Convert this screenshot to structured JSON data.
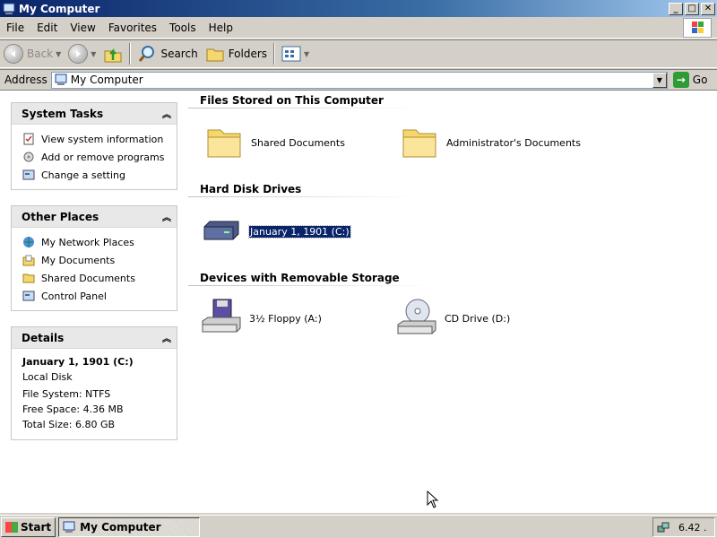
{
  "window": {
    "title": "My Computer",
    "buttons": {
      "minimize": "_",
      "maximize": "□",
      "close": "✕"
    }
  },
  "menu": [
    "File",
    "Edit",
    "View",
    "Favorites",
    "Tools",
    "Help"
  ],
  "toolbar": {
    "back_label": "Back",
    "search_label": "Search",
    "folders_label": "Folders"
  },
  "address": {
    "label": "Address",
    "value": "My Computer",
    "go_label": "Go"
  },
  "tasks_pane": {
    "title": "System Tasks",
    "items": [
      "View system information",
      "Add or remove programs",
      "Change a setting"
    ]
  },
  "places_pane": {
    "title": "Other Places",
    "items": [
      "My Network Places",
      "My Documents",
      "Shared Documents",
      "Control Panel"
    ]
  },
  "details_pane": {
    "title": "Details",
    "name": "January 1, 1901 (C:)",
    "type": "Local Disk",
    "file_system": "File System: NTFS",
    "free_space": "Free Space: 4.36 MB",
    "total_size": "Total Size: 6.80 GB"
  },
  "groups": {
    "files_title": "Files Stored on This Computer",
    "files": [
      "Shared Documents",
      "Administrator's Documents"
    ],
    "hdd_title": "Hard Disk Drives",
    "hdd": [
      "January 1, 1901 (C:)"
    ],
    "removable_title": "Devices with Removable Storage",
    "removable": [
      "3½ Floppy (A:)",
      "CD Drive (D:)"
    ]
  },
  "taskbar": {
    "start_label": "Start",
    "window_label": "My Computer",
    "clock": "6.42 ."
  },
  "colors": {
    "title_gradient_start": "#0a246a",
    "selection": "#0a246a",
    "go_green": "#2e9b35",
    "folder_yellow": "#f5d76e"
  },
  "icons": [
    "computer-icon",
    "back-icon",
    "forward-icon",
    "up-folder-icon",
    "search-icon",
    "folders-icon",
    "views-icon",
    "go-arrow-icon",
    "folder-icon",
    "hard-drive-icon",
    "floppy-drive-icon",
    "cd-drive-icon"
  ]
}
